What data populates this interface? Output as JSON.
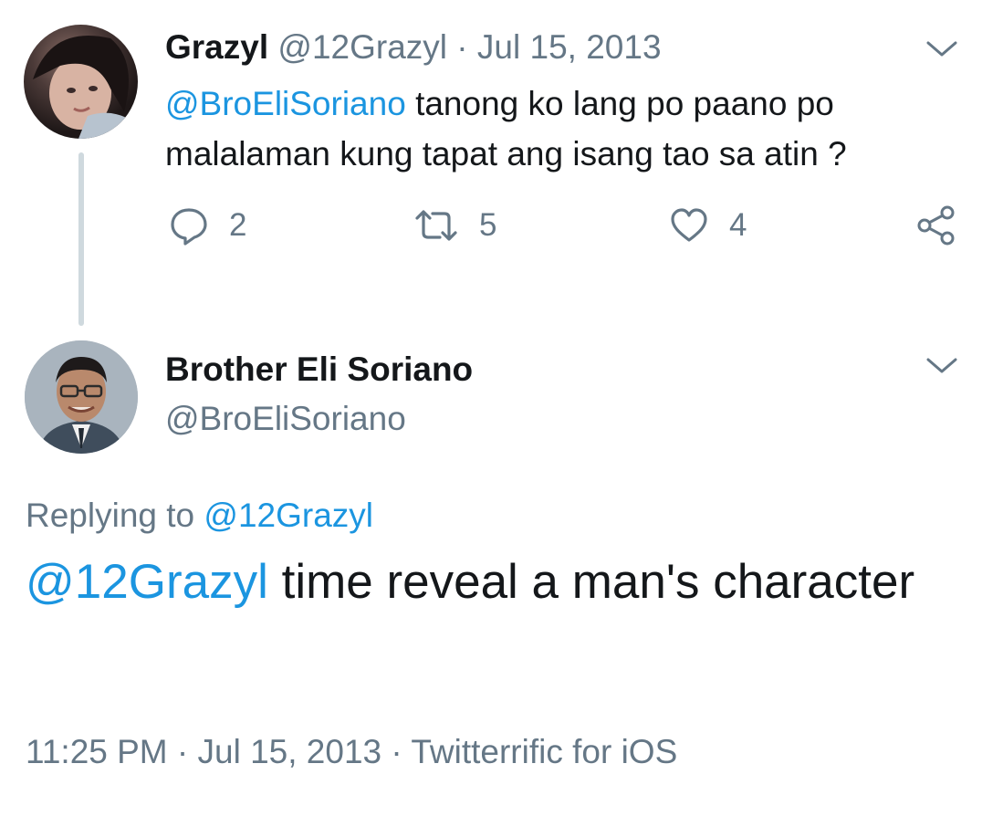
{
  "parent_tweet": {
    "name": "Grazyl",
    "handle": "@12Grazyl",
    "separator": " · ",
    "date": "Jul 15, 2013",
    "mention": "@BroEliSoriano",
    "text": " tanong ko lang po paano po malalaman kung tapat ang isang tao sa atin ?",
    "actions": {
      "reply_count": "2",
      "retweet_count": "5",
      "like_count": "4"
    },
    "icons": {
      "reply": "reply-icon",
      "retweet": "retweet-icon",
      "like": "heart-icon",
      "share": "share-icon",
      "menu": "chevron-down-icon"
    }
  },
  "reply_tweet": {
    "name": "Brother Eli Soriano",
    "handle": "@BroEliSoriano",
    "replying_label": "Replying to ",
    "replying_handle": "@12Grazyl",
    "mention": "@12Grazyl",
    "text": " time reveal a man's character",
    "time": "11:25 PM",
    "separator": " · ",
    "date": "Jul 15, 2013",
    "source": "Twitterrific for iOS"
  },
  "colors": {
    "link": "#1b95e0",
    "secondary_text": "#657786",
    "primary_text": "#14171a",
    "thread_line": "#cfd9de"
  }
}
